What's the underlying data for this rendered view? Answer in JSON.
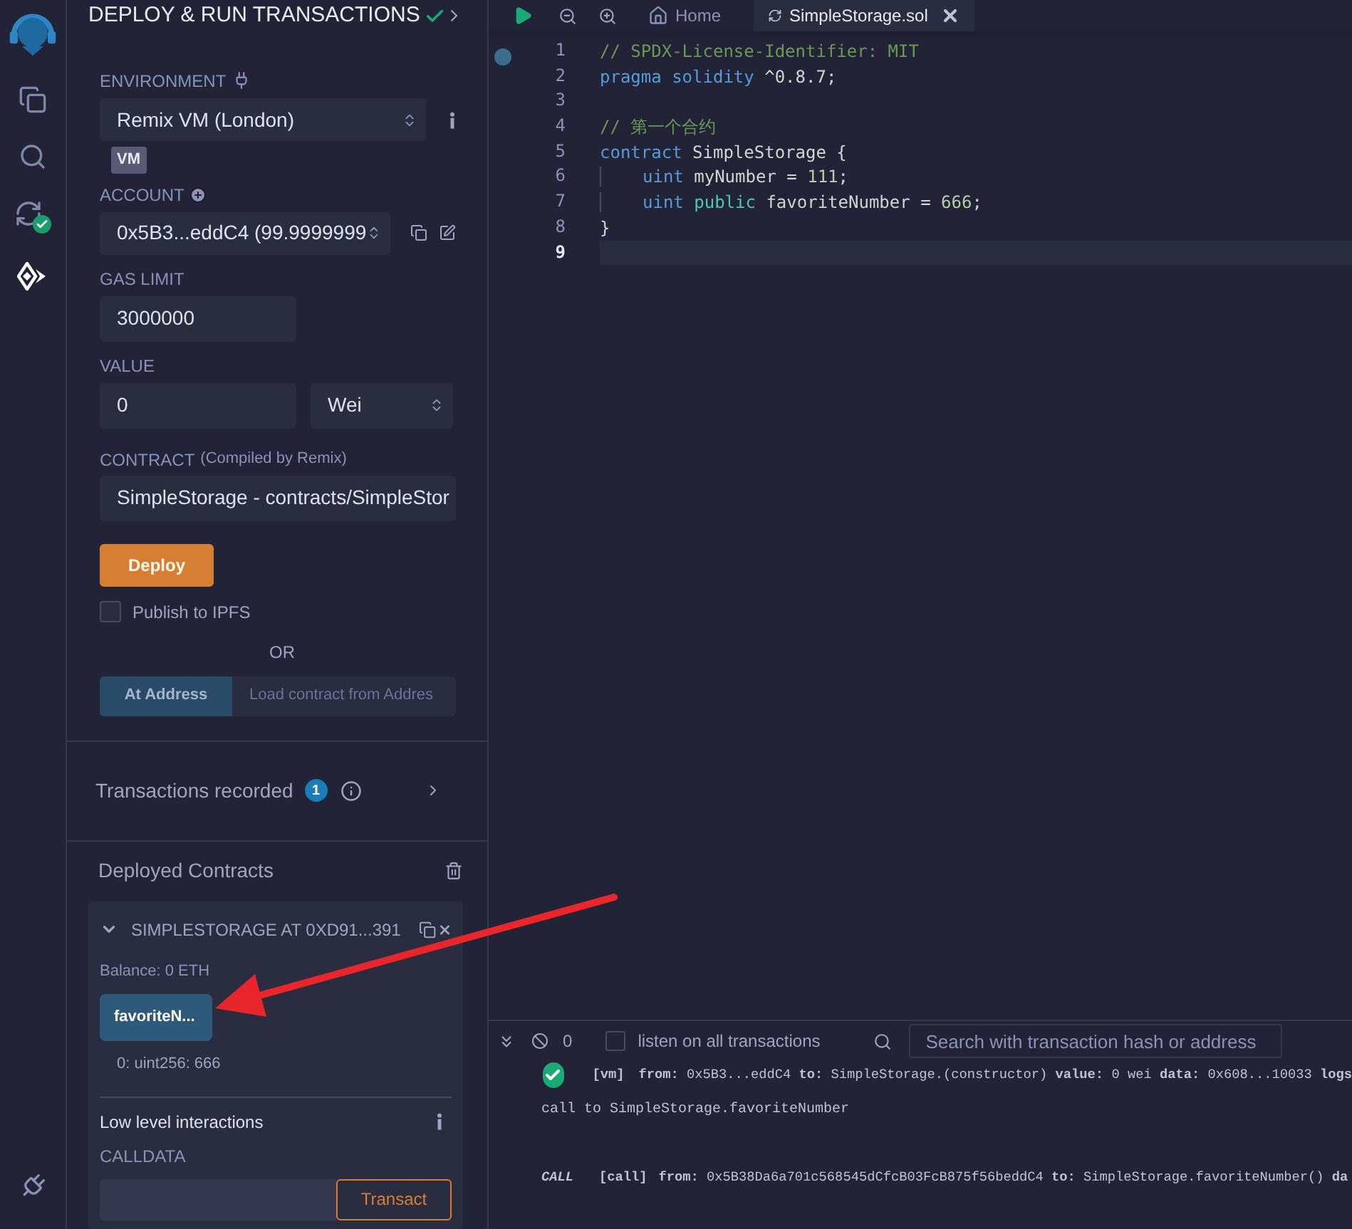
{
  "icon_bar": {
    "items": [
      {
        "kind": "files",
        "selected": false
      },
      {
        "kind": "search",
        "selected": false
      },
      {
        "kind": "compiler",
        "selected": false
      },
      {
        "kind": "deploy",
        "selected": true
      }
    ]
  },
  "panel": {
    "title": "DEPLOY & RUN TRANSACTIONS",
    "environment": {
      "label": "ENVIRONMENT",
      "value": "Remix VM (London)",
      "badge": "VM"
    },
    "account": {
      "label": "ACCOUNT",
      "value": "0x5B3...eddC4 (99.9999999"
    },
    "gas_limit": {
      "label": "GAS LIMIT",
      "value": "3000000"
    },
    "value": {
      "label": "VALUE",
      "amount": "0",
      "unit": "Wei"
    },
    "contract": {
      "label": "CONTRACT",
      "note": "(Compiled by Remix)",
      "value": "SimpleStorage - contracts/SimpleStor"
    },
    "deploy_button": "Deploy",
    "publish": {
      "label": "Publish to IPFS",
      "checked": false
    },
    "or": "OR",
    "at_address": {
      "button": "At Address",
      "placeholder": "Load contract from Addres"
    },
    "transactions": {
      "label": "Transactions recorded",
      "count": "1"
    },
    "deployed": {
      "title": "Deployed Contracts",
      "instances": [
        {
          "title": "SIMPLESTORAGE AT 0XD91...391",
          "expanded": true,
          "balance": "Balance: 0 ETH",
          "functions": [
            {
              "label": "favoriteN...",
              "result": "0: uint256: 666"
            }
          ],
          "low_level": "Low level interactions",
          "calldata_label": "CALLDATA",
          "transact": "Transact"
        }
      ]
    }
  },
  "editor": {
    "tabs": [
      {
        "kind": "home",
        "label": "Home",
        "selected": false
      },
      {
        "kind": "file",
        "label": "SimpleStorage.sol",
        "selected": true
      }
    ],
    "lines": [
      {
        "number": "1",
        "selected": false,
        "tokens": [
          {
            "kind": "comment",
            "text": "// SPDX-License-Identifier: MIT"
          }
        ]
      },
      {
        "number": "2",
        "selected": false,
        "tokens": [
          {
            "kind": "keyword",
            "text": "pragma solidity"
          },
          {
            "kind": "plain",
            "text": " ^0.8.7;"
          }
        ]
      },
      {
        "number": "3",
        "selected": false
      },
      {
        "number": "4",
        "selected": false,
        "tokens": [
          {
            "kind": "comment",
            "text": "// 第一个合约"
          }
        ]
      },
      {
        "number": "5",
        "selected": false,
        "tokens": [
          {
            "kind": "keyword",
            "text": "contract"
          },
          {
            "kind": "plain",
            "text": " SimpleStorage {"
          }
        ]
      },
      {
        "number": "6",
        "selected": false,
        "indented": true,
        "tokens": [
          {
            "kind": "keyword",
            "text": "uint"
          },
          {
            "kind": "plain",
            "text": " myNumber = "
          },
          {
            "kind": "number",
            "text": "111"
          },
          {
            "kind": "plain",
            "text": ";"
          }
        ]
      },
      {
        "number": "7",
        "selected": false,
        "indented": true,
        "tokens": [
          {
            "kind": "keyword",
            "text": "uint"
          },
          {
            "kind": "modifier",
            "text": " public"
          },
          {
            "kind": "plain",
            "text": " favoriteNumber = "
          },
          {
            "kind": "number",
            "text": "666"
          },
          {
            "kind": "plain",
            "text": ";"
          }
        ]
      },
      {
        "number": "8",
        "selected": false,
        "tokens": [
          {
            "kind": "plain",
            "text": "}"
          }
        ]
      },
      {
        "number": "9",
        "selected": true
      }
    ]
  },
  "terminal": {
    "pending": "0",
    "listen": {
      "label": "listen on all transactions",
      "checked": false
    },
    "search_placeholder": "Search with transaction hash or address",
    "logs": [
      {
        "kind": "success",
        "tag": "[vm]",
        "text": "**from:** 0x5B3...eddC4 **to:** SimpleStorage.(constructor) **value:** 0 wei **data:** 0x608...10033 **logs**"
      },
      {
        "kind": "message",
        "text": "call to SimpleStorage.favoriteNumber"
      },
      {
        "kind": "call",
        "label": "CALL",
        "tag": "[call]",
        "text": "**from:** 0x5B38Da6a701c568545dCfcB03FcB875f56beddC4 **to:** SimpleStorage.favoriteNumber() **da**"
      }
    ]
  }
}
